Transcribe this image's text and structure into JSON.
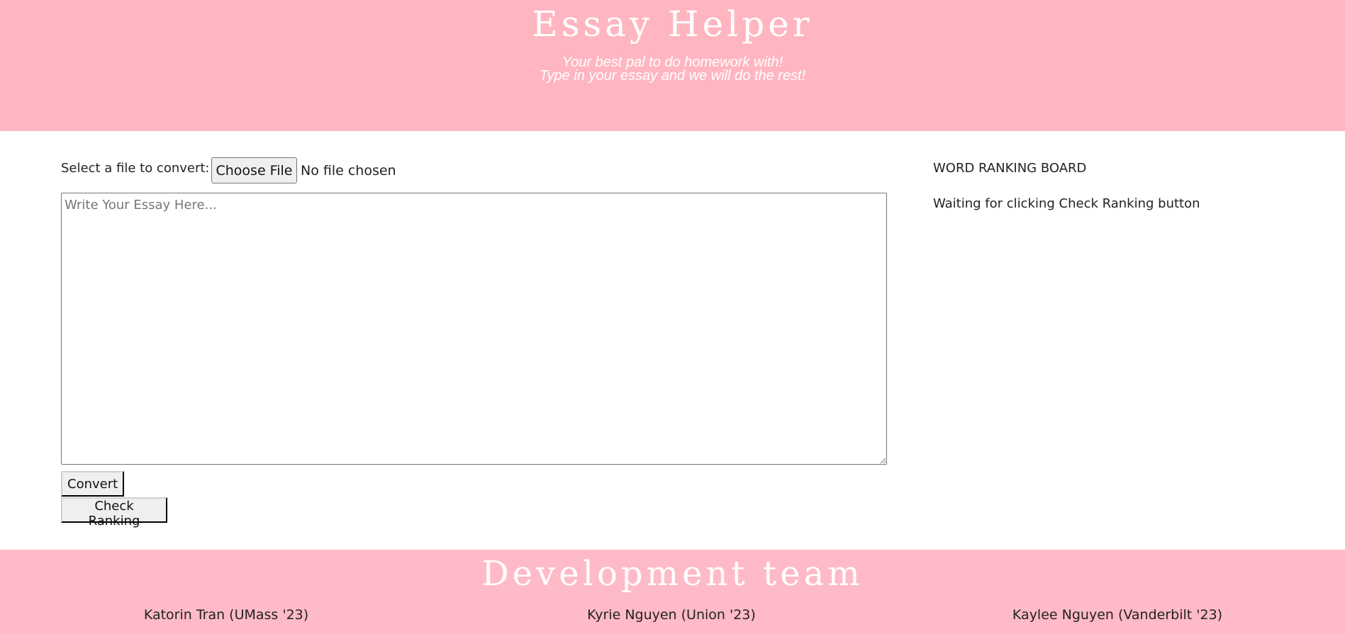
{
  "header": {
    "title": "Essay Helper",
    "tagline_line1": "Your best pal to do homework with!",
    "tagline_line2": "Type in your essay and we will do the rest!",
    "background_color": "#ffb6c1"
  },
  "converter": {
    "file_label": "Select a file to convert:",
    "choose_file_label": "Choose File",
    "file_status": "No file chosen",
    "essay_placeholder": "Write Your Essay Here...",
    "essay_value": "",
    "convert_label": "Convert",
    "check_ranking_label": "Check Ranking"
  },
  "ranking_board": {
    "title": "WORD RANKING BOARD",
    "status": "Waiting for clicking Check Ranking button"
  },
  "footer": {
    "title": "Development team",
    "members": [
      "Katorin Tran (UMass '23)",
      "Kyrie Nguyen (Union '23)",
      "Kaylee Nguyen (Vanderbilt '23)"
    ],
    "background_color": "#ffbac7"
  }
}
